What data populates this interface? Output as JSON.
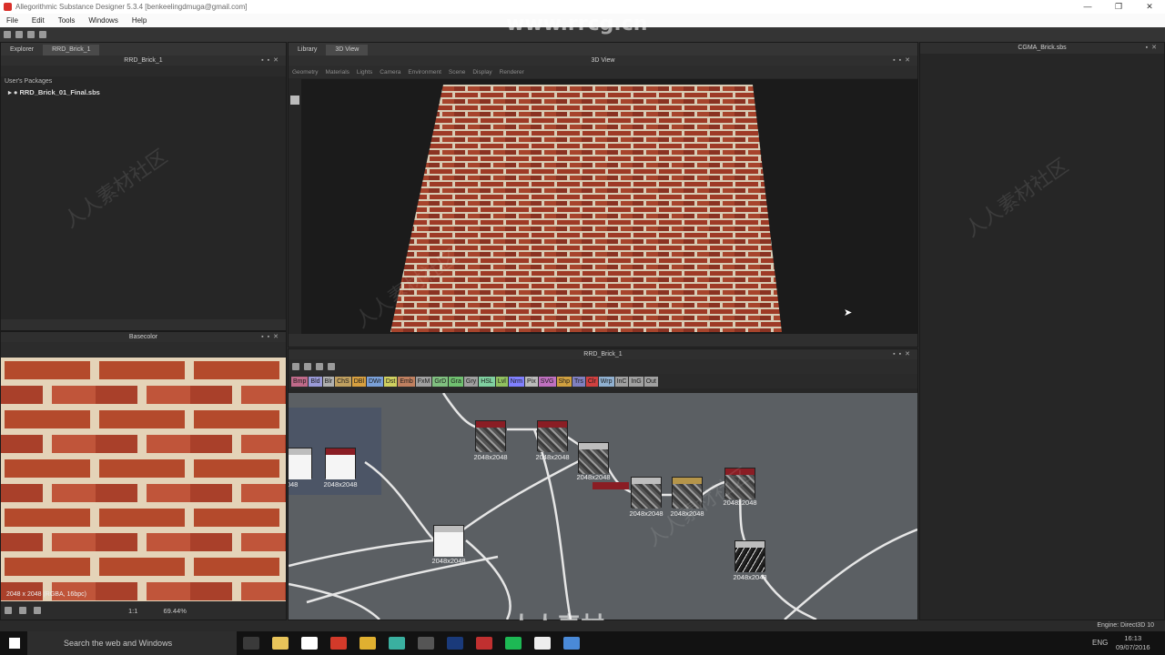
{
  "window": {
    "title": "Allegorithmic Substance Designer 5.3.4 [benkeelingdmuga@gmail.com]",
    "controls": [
      "—",
      "❐",
      "✕"
    ],
    "watermark_url": "www.rrcg.cn",
    "watermark_cn": "人人素材社区",
    "watermark_brand": "人人素材"
  },
  "menu": [
    "File",
    "Edit",
    "Tools",
    "Windows",
    "Help"
  ],
  "explorer": {
    "tabs": [
      "Explorer",
      "RRD_Brick_1"
    ],
    "header": "RRD_Brick_1",
    "section": "User's Packages",
    "package": "RRD_Brick_01_Final.sbs"
  },
  "view3d": {
    "tabs": [
      "Library",
      "3D View"
    ],
    "header": "3D View",
    "menus": [
      "Geometry",
      "Materials",
      "Lights",
      "Camera",
      "Environment",
      "Scene",
      "Display",
      "Renderer"
    ]
  },
  "right_panel": {
    "header": "CGMA_Brick.sbs"
  },
  "view2d": {
    "header": "Basecolor",
    "status": "2048 x 2048 (RGBA, 16bpc)",
    "ratio": "1:1",
    "zoom": "69.44%"
  },
  "graph": {
    "header": "RRD_Brick_1",
    "library_buttons": [
      {
        "label": "Bmp",
        "color": "#c06a8a"
      },
      {
        "label": "Bld",
        "color": "#9a9ad8"
      },
      {
        "label": "Blr",
        "color": "#b0b0b0"
      },
      {
        "label": "ChS",
        "color": "#c0a060"
      },
      {
        "label": "DBl",
        "color": "#d8a040"
      },
      {
        "label": "DWr",
        "color": "#7aa0d8"
      },
      {
        "label": "Dst",
        "color": "#d0d060"
      },
      {
        "label": "Emb",
        "color": "#c08060"
      },
      {
        "label": "FxM",
        "color": "#a0a0a0"
      },
      {
        "label": "GrD",
        "color": "#80c080"
      },
      {
        "label": "Gra",
        "color": "#70c070"
      },
      {
        "label": "Gry",
        "color": "#a0a0a0"
      },
      {
        "label": "HSL",
        "color": "#80d0a0"
      },
      {
        "label": "Lvl",
        "color": "#90c060"
      },
      {
        "label": "Nrm",
        "color": "#8080ff"
      },
      {
        "label": "Pix",
        "color": "#bbbbbb"
      },
      {
        "label": "SVG",
        "color": "#c070c0"
      },
      {
        "label": "Shp",
        "color": "#d0a040"
      },
      {
        "label": "Trs",
        "color": "#8080c0"
      },
      {
        "label": "Clr",
        "color": "#d04040"
      },
      {
        "label": "Wrp",
        "color": "#90b0d0"
      },
      {
        "label": "InC",
        "color": "#a0a0a0"
      },
      {
        "label": "InG",
        "color": "#a0a0a0"
      },
      {
        "label": "Out",
        "color": "#a0a0a0"
      }
    ],
    "size_label": "2048x2048",
    "partial_label": "2048"
  },
  "statusbar": {
    "engine": "Engine: Direct3D 10"
  },
  "taskbar": {
    "search": "Search the web and Windows",
    "lang": "ENG",
    "time": "16:13",
    "date": "09/07/2016"
  }
}
